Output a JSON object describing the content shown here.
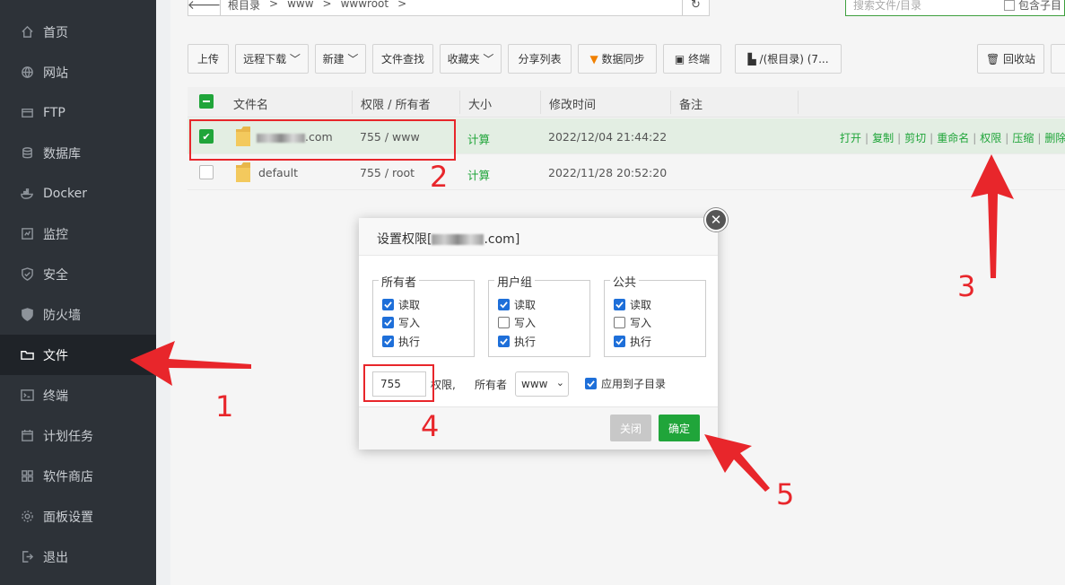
{
  "sidebar": {
    "items": [
      {
        "label": "首页",
        "icon": "home-icon"
      },
      {
        "label": "网站",
        "icon": "globe-icon"
      },
      {
        "label": "FTP",
        "icon": "ftp-icon"
      },
      {
        "label": "数据库",
        "icon": "database-icon"
      },
      {
        "label": "Docker",
        "icon": "docker-icon"
      },
      {
        "label": "监控",
        "icon": "monitor-icon"
      },
      {
        "label": "安全",
        "icon": "shield-icon"
      },
      {
        "label": "防火墙",
        "icon": "firewall-icon"
      },
      {
        "label": "文件",
        "icon": "folder-icon",
        "active": true
      },
      {
        "label": "终端",
        "icon": "terminal-icon"
      },
      {
        "label": "计划任务",
        "icon": "calendar-icon"
      },
      {
        "label": "软件商店",
        "icon": "apps-icon"
      },
      {
        "label": "面板设置",
        "icon": "gear-icon"
      },
      {
        "label": "退出",
        "icon": "logout-icon"
      }
    ]
  },
  "pathbar": {
    "crumbs": [
      "根目录",
      ">",
      "www",
      ">",
      "wwwroot",
      ">"
    ],
    "search_placeholder": "搜索文件/目录",
    "include_sub": "包含子目"
  },
  "toolbar": {
    "upload": "上传",
    "remote_download": "远程下载",
    "new": "新建",
    "find": "文件查找",
    "favorites": "收藏夹",
    "share_list": "分享列表",
    "data_sync": "数据同步",
    "terminal": "终端",
    "disk": "/(根目录) (7...",
    "recycle": "回收站"
  },
  "table": {
    "headers": {
      "name": "文件名",
      "perm": "权限 / 所有者",
      "size": "大小",
      "mtime": "修改时间",
      "note": "备注"
    },
    "rows": [
      {
        "name": ".com",
        "perm": "755 / www",
        "size": "计算",
        "mtime": "2022/12/04 21:44:22",
        "selected": true
      },
      {
        "name": "default",
        "perm": "755 / root",
        "size": "计算",
        "mtime": "2022/11/28 20:52:20",
        "selected": false
      }
    ],
    "row_actions": [
      "打开",
      "复制",
      "剪切",
      "重命名",
      "权限",
      "压缩",
      "删除"
    ]
  },
  "dialog": {
    "title_prefix": "设置权限[",
    "title_suffix": ".com]",
    "groups": [
      {
        "label": "所有者",
        "read": "读取",
        "write": "写入",
        "exec": "执行",
        "read_on": true,
        "write_on": true,
        "exec_on": true
      },
      {
        "label": "用户组",
        "read": "读取",
        "write": "写入",
        "exec": "执行",
        "read_on": true,
        "write_on": false,
        "exec_on": true
      },
      {
        "label": "公共",
        "read": "读取",
        "write": "写入",
        "exec": "执行",
        "read_on": true,
        "write_on": false,
        "exec_on": true
      }
    ],
    "perm_value": "755",
    "perm_label": "权限,",
    "owner_label": "所有者",
    "owner_value": "www",
    "apply_sub": "应用到子目录",
    "close_btn": "关闭",
    "ok_btn": "确定"
  },
  "annotations": [
    "1",
    "2",
    "3",
    "4",
    "5"
  ],
  "colors": {
    "accent": "#20a53a",
    "annotation": "#e8262b",
    "sidebar": "#2d3238"
  }
}
